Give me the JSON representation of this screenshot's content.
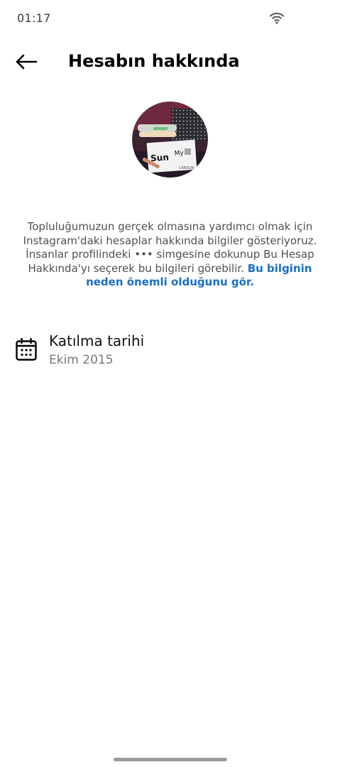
{
  "status_bar": {
    "time": "01:17",
    "wifi_icon": "wifi-icon"
  },
  "header": {
    "back_icon": "arrow-left-icon",
    "title": "Hesabın hakkında"
  },
  "profile": {
    "avatar_icon": "profile-photo"
  },
  "info": {
    "text": "Topluluğumuzun gerçek olmasına yardımcı olmak için Instagram'daki hesaplar hakkında bilgiler gösteriyoruz. İnsanlar profilindeki ••• simgesine dokunup Bu Hesap Hakkında'yı seçerek bu bilgileri görebilir.",
    "link": "Bu bilginin neden önemli olduğunu gör."
  },
  "joined": {
    "icon": "calendar-icon",
    "label": "Katılma tarihi",
    "value": "Ekim 2015"
  },
  "colors": {
    "link": "#1a6fc2",
    "secondary_text": "#777777",
    "home_indicator": "#9a9a9a"
  }
}
